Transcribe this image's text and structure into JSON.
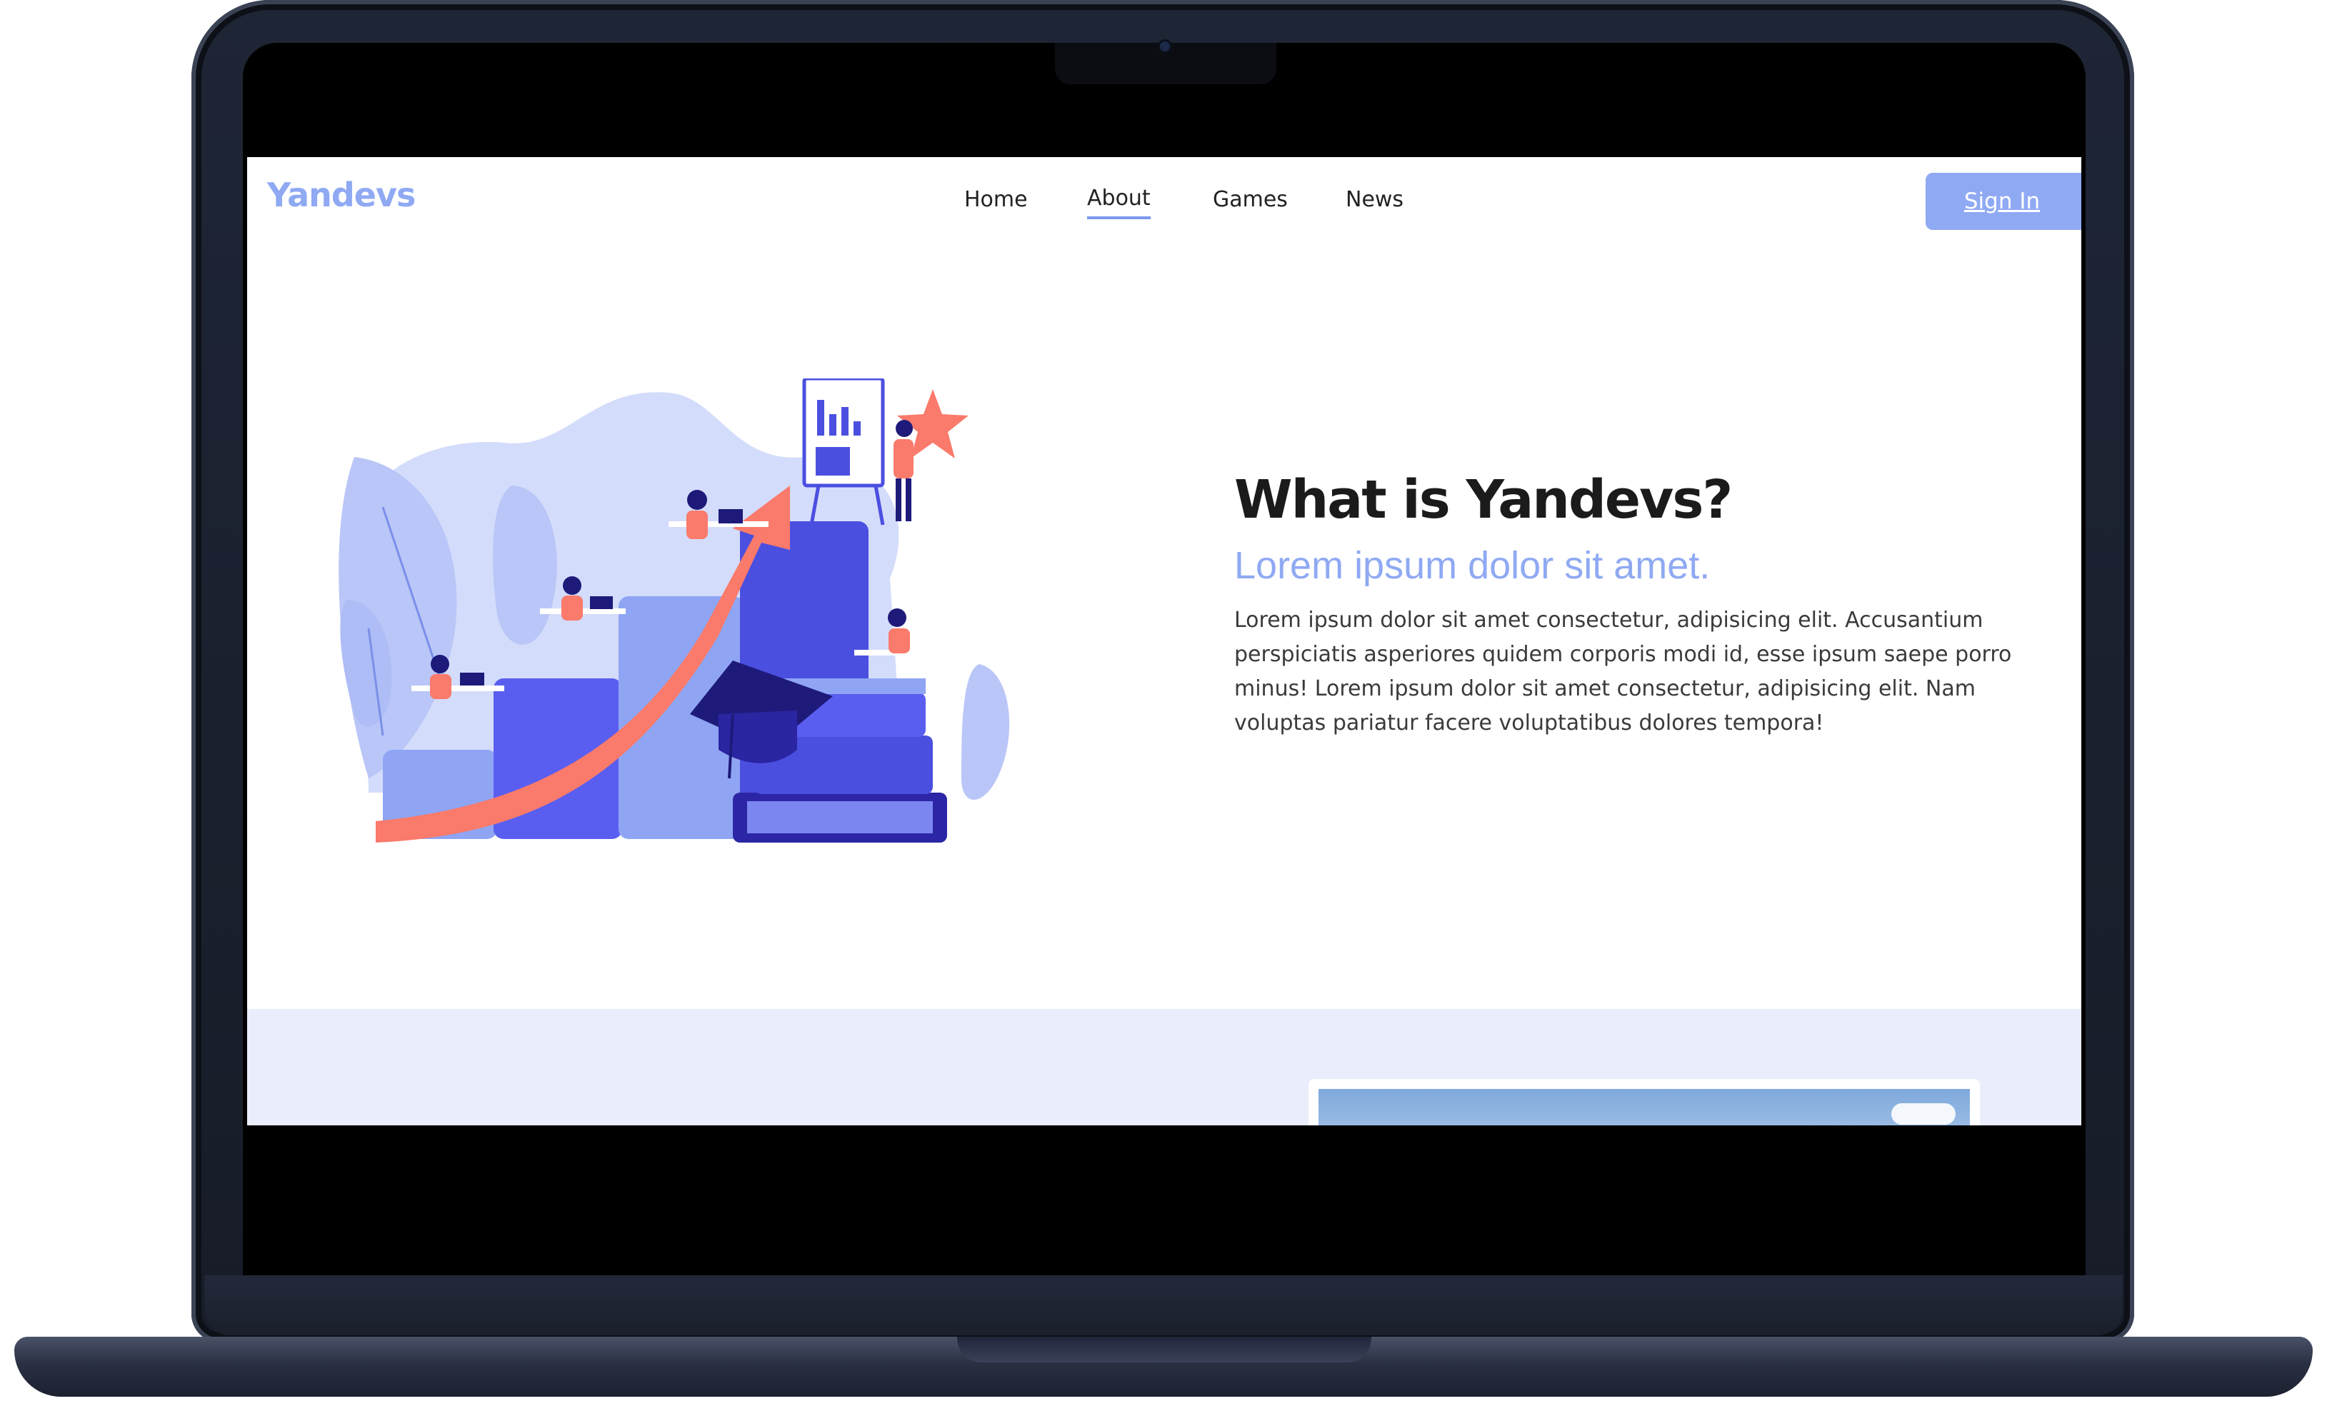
{
  "navbar": {
    "logo": "Yandevs",
    "links": [
      "Home",
      "About",
      "Games",
      "News"
    ],
    "active": "About",
    "sign_in": "Sign In"
  },
  "hero": {
    "title": "What is Yandevs?",
    "subtitle": "Lorem ipsum dolor sit amet.",
    "body": "Lorem ipsum dolor sit amet consectetur, adipisicing elit. Accusantium perspiciatis asperiores quidem corporis modi id, esse ipsum saepe porro minus! Lorem ipsum dolor sit amet consectetur, adipisicing elit. Nam voluptas pariatur facere voluptatibus dolores tempora!"
  },
  "colors": {
    "accent": "#8fa9f3",
    "section_bg": "#e9edfc",
    "illustration_coral": "#fa7a6b",
    "illustration_indigo": "#4b4fe0",
    "illustration_navy": "#1e1a7a"
  },
  "icons": [
    "camera-icon",
    "star-icon",
    "graduation-cap-icon",
    "trend-arrow-icon",
    "presentation-board-icon"
  ]
}
